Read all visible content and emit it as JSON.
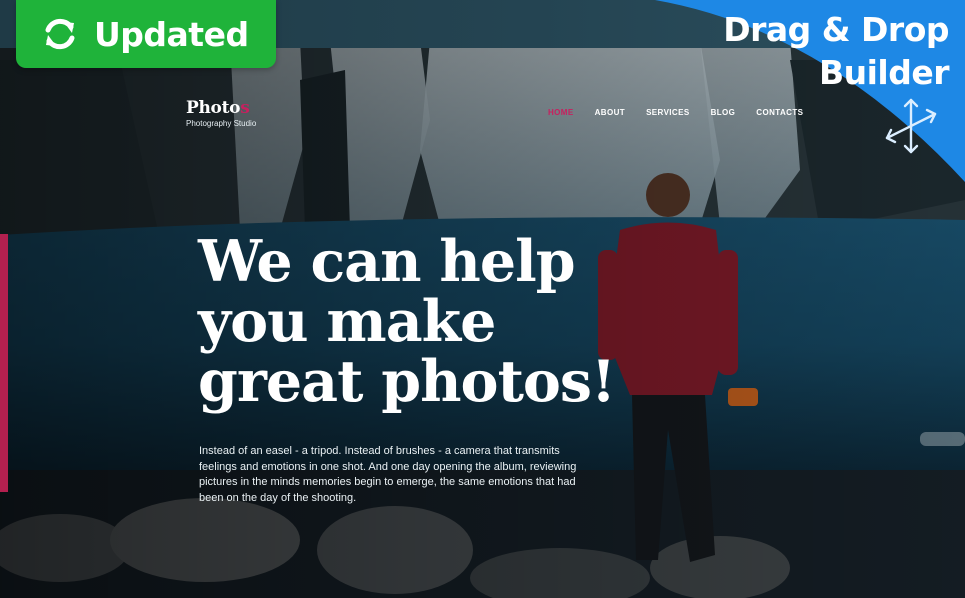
{
  "badge": {
    "label": "Updated",
    "icon": "refresh-icon",
    "color": "#1fb33a"
  },
  "builder": {
    "line1": "Drag & Drop",
    "line2": "Builder",
    "icon": "move-arrows-icon",
    "color": "#1e88e5"
  },
  "brand": {
    "name_main": "Photo",
    "name_accent": "s",
    "tagline": "Photography Studio"
  },
  "nav": {
    "items": [
      {
        "label": "HOME",
        "active": true
      },
      {
        "label": "ABOUT",
        "active": false
      },
      {
        "label": "SERVICES",
        "active": false
      },
      {
        "label": "BLOG",
        "active": false
      },
      {
        "label": "CONTACTS",
        "active": false
      }
    ]
  },
  "hero": {
    "headline_line1": "We can help",
    "headline_line2": "you make",
    "headline_line3": "great photos!",
    "intro": "Instead of an easel - a tripod. Instead of brushes - a camera that transmits feelings and emotions in one shot. And one day opening the album, reviewing pictures in the minds memories begin to emerge, the same emotions that had been on the day of the shooting."
  },
  "colors": {
    "accent": "#c7205f",
    "side_bar": "#b3204f"
  }
}
